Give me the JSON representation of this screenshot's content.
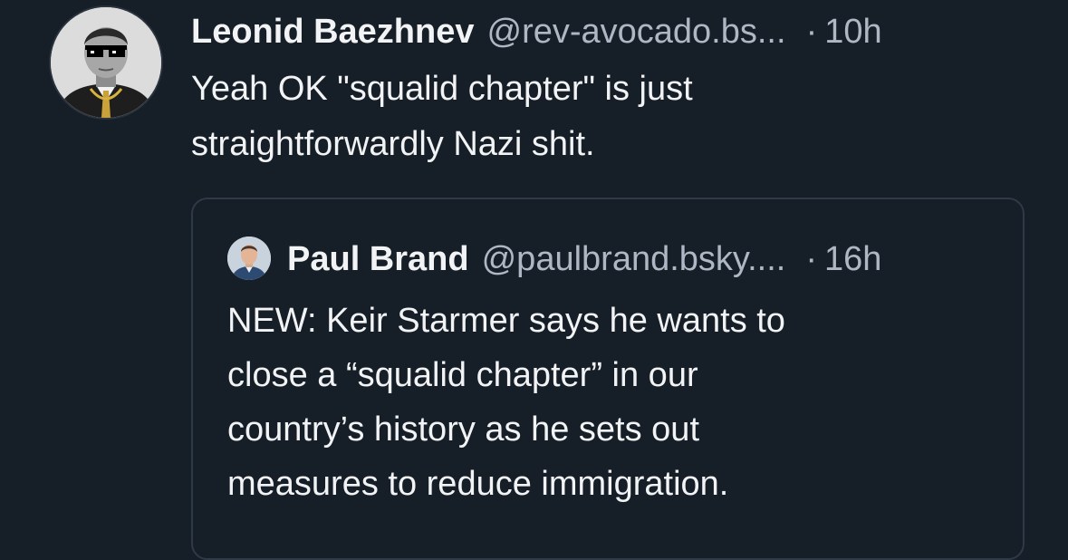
{
  "post": {
    "author": {
      "display_name": "Leonid Baezhnev",
      "handle": "@rev-avocado.bs...",
      "avatar_icon": "avatar-image"
    },
    "separator": "·",
    "time": "10h",
    "text": "Yeah OK \"squalid chapter\" is just\nstraightforwardly Nazi shit."
  },
  "quote": {
    "author": {
      "display_name": "Paul Brand",
      "handle": "@paulbrand.bsky....",
      "avatar_icon": "avatar-image"
    },
    "separator": "·",
    "time": "16h",
    "text": "NEW: Keir Starmer says he wants to\nclose a “squalid chapter” in our\ncountry’s history as he sets out\nmeasures to reduce immigration."
  },
  "colors": {
    "background": "#161e27",
    "text_primary": "#f1f3f5",
    "text_secondary": "#aeb8c4",
    "border": "#2e3a48"
  }
}
